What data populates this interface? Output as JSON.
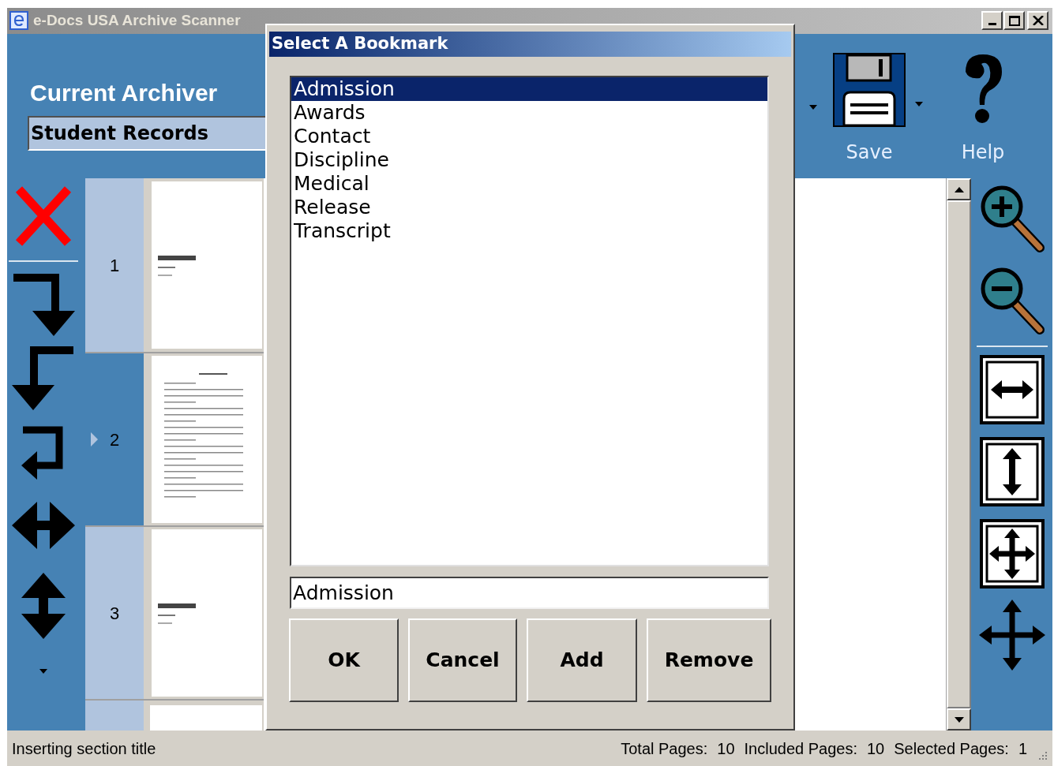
{
  "window": {
    "title": "e-Docs USA Archive Scanner"
  },
  "header": {
    "heading": "Current Archiver",
    "archive_field": "Student Records"
  },
  "toolbar": [
    {
      "label": "Save",
      "kind": "save"
    },
    {
      "label": "Help",
      "kind": "help"
    }
  ],
  "pages": [
    {
      "number": "1",
      "selected": false,
      "kind": "barcode"
    },
    {
      "number": "2",
      "selected": true,
      "kind": "form"
    },
    {
      "number": "3",
      "selected": false,
      "kind": "barcode"
    }
  ],
  "status_bar": {
    "message": "Inserting section title",
    "total_label": "Total Pages:",
    "total": "10",
    "included_label": "Included Pages:",
    "included": "10",
    "selected_label": "Selected Pages:",
    "selected_count": "1"
  },
  "dialog": {
    "title": "Select A Bookmark",
    "items": [
      {
        "label": "Admission",
        "selected": true
      },
      {
        "label": "Awards",
        "selected": false
      },
      {
        "label": "Contact",
        "selected": false
      },
      {
        "label": "Discipline",
        "selected": false
      },
      {
        "label": "Medical",
        "selected": false
      },
      {
        "label": "Release",
        "selected": false
      },
      {
        "label": "Transcript",
        "selected": false
      }
    ],
    "name_field": "Admission",
    "buttons": [
      "OK",
      "Cancel",
      "Add",
      "Remove"
    ]
  }
}
